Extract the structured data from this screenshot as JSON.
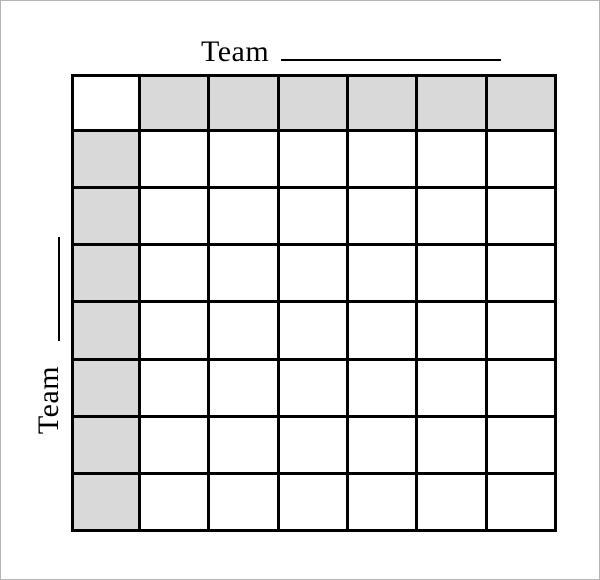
{
  "page": {
    "title": "Football Squares Pool Grid",
    "background_color": "#ffffff",
    "frame_color": "#b3b3b3"
  },
  "colors": {
    "grid_line": "#000000",
    "header_fill": "#d9d9d9",
    "cell_fill": "#ffffff"
  },
  "top_axis": {
    "label": "Team",
    "fill_line": "",
    "fill_line_name": "team-name-blank-line"
  },
  "left_axis": {
    "label": "Team",
    "fill_line": "",
    "fill_line_name": "team-name-blank-line"
  },
  "grid": {
    "total_rows": 8,
    "total_columns": 7,
    "header_row_cells": 6,
    "header_column_cells": 7,
    "corner_cell_label": "",
    "rows": [
      {
        "type": "header",
        "cells": [
          {
            "style": "blank",
            "value": ""
          },
          {
            "style": "shaded",
            "value": ""
          },
          {
            "style": "shaded",
            "value": ""
          },
          {
            "style": "shaded",
            "value": ""
          },
          {
            "style": "shaded",
            "value": ""
          },
          {
            "style": "shaded",
            "value": ""
          },
          {
            "style": "shaded",
            "value": ""
          }
        ]
      },
      {
        "type": "body",
        "cells": [
          {
            "style": "shaded",
            "value": ""
          },
          {
            "style": "blank",
            "value": ""
          },
          {
            "style": "blank",
            "value": ""
          },
          {
            "style": "blank",
            "value": ""
          },
          {
            "style": "blank",
            "value": ""
          },
          {
            "style": "blank",
            "value": ""
          },
          {
            "style": "blank",
            "value": ""
          }
        ]
      },
      {
        "type": "body",
        "cells": [
          {
            "style": "shaded",
            "value": ""
          },
          {
            "style": "blank",
            "value": ""
          },
          {
            "style": "blank",
            "value": ""
          },
          {
            "style": "blank",
            "value": ""
          },
          {
            "style": "blank",
            "value": ""
          },
          {
            "style": "blank",
            "value": ""
          },
          {
            "style": "blank",
            "value": ""
          }
        ]
      },
      {
        "type": "body",
        "cells": [
          {
            "style": "shaded",
            "value": ""
          },
          {
            "style": "blank",
            "value": ""
          },
          {
            "style": "blank",
            "value": ""
          },
          {
            "style": "blank",
            "value": ""
          },
          {
            "style": "blank",
            "value": ""
          },
          {
            "style": "blank",
            "value": ""
          },
          {
            "style": "blank",
            "value": ""
          }
        ]
      },
      {
        "type": "body",
        "cells": [
          {
            "style": "shaded",
            "value": ""
          },
          {
            "style": "blank",
            "value": ""
          },
          {
            "style": "blank",
            "value": ""
          },
          {
            "style": "blank",
            "value": ""
          },
          {
            "style": "blank",
            "value": ""
          },
          {
            "style": "blank",
            "value": ""
          },
          {
            "style": "blank",
            "value": ""
          }
        ]
      },
      {
        "type": "body",
        "cells": [
          {
            "style": "shaded",
            "value": ""
          },
          {
            "style": "blank",
            "value": ""
          },
          {
            "style": "blank",
            "value": ""
          },
          {
            "style": "blank",
            "value": ""
          },
          {
            "style": "blank",
            "value": ""
          },
          {
            "style": "blank",
            "value": ""
          },
          {
            "style": "blank",
            "value": ""
          }
        ]
      },
      {
        "type": "body",
        "cells": [
          {
            "style": "shaded",
            "value": ""
          },
          {
            "style": "blank",
            "value": ""
          },
          {
            "style": "blank",
            "value": ""
          },
          {
            "style": "blank",
            "value": ""
          },
          {
            "style": "blank",
            "value": ""
          },
          {
            "style": "blank",
            "value": ""
          },
          {
            "style": "blank",
            "value": ""
          }
        ]
      },
      {
        "type": "body",
        "cells": [
          {
            "style": "shaded",
            "value": ""
          },
          {
            "style": "blank",
            "value": ""
          },
          {
            "style": "blank",
            "value": ""
          },
          {
            "style": "blank",
            "value": ""
          },
          {
            "style": "blank",
            "value": ""
          },
          {
            "style": "blank",
            "value": ""
          },
          {
            "style": "blank",
            "value": ""
          }
        ]
      }
    ]
  }
}
